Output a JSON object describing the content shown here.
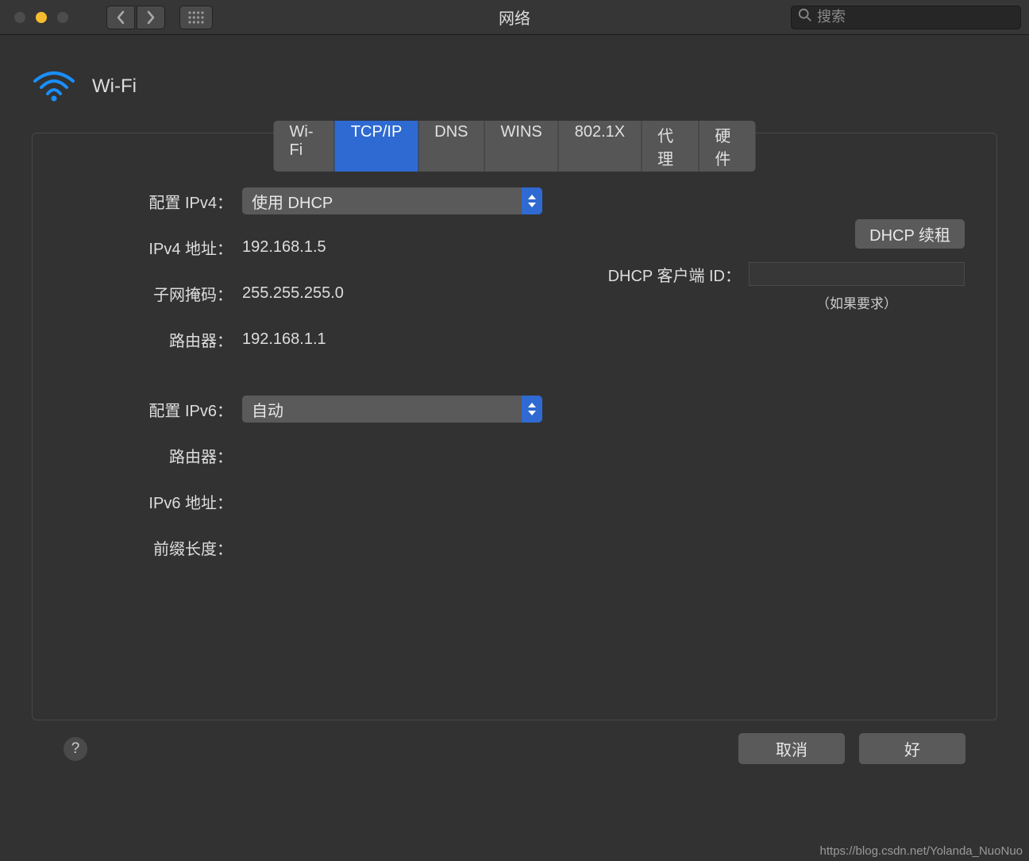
{
  "titlebar": {
    "title": "网络",
    "search_placeholder": "搜索"
  },
  "header": {
    "title": "Wi-Fi"
  },
  "tabs": [
    {
      "label": "Wi-Fi",
      "active": false
    },
    {
      "label": "TCP/IP",
      "active": true
    },
    {
      "label": "DNS",
      "active": false
    },
    {
      "label": "WINS",
      "active": false
    },
    {
      "label": "802.1X",
      "active": false
    },
    {
      "label": "代理",
      "active": false
    },
    {
      "label": "硬件",
      "active": false
    }
  ],
  "ipv4": {
    "config_label": "配置 IPv4：",
    "config_value": "使用 DHCP",
    "address_label": "IPv4 地址：",
    "address_value": "192.168.1.5",
    "subnet_label": "子网掩码：",
    "subnet_value": "255.255.255.0",
    "router_label": "路由器：",
    "router_value": "192.168.1.1"
  },
  "dhcp": {
    "renew_label": "DHCP 续租",
    "client_id_label": "DHCP 客户端 ID：",
    "client_id_value": "",
    "hint": "（如果要求）"
  },
  "ipv6": {
    "config_label": "配置 IPv6：",
    "config_value": "自动",
    "router_label": "路由器：",
    "router_value": "",
    "address_label": "IPv6 地址：",
    "address_value": "",
    "prefix_label": "前缀长度：",
    "prefix_value": ""
  },
  "footer": {
    "cancel": "取消",
    "ok": "好"
  },
  "watermark": "https://blog.csdn.net/Yolanda_NuoNuo"
}
